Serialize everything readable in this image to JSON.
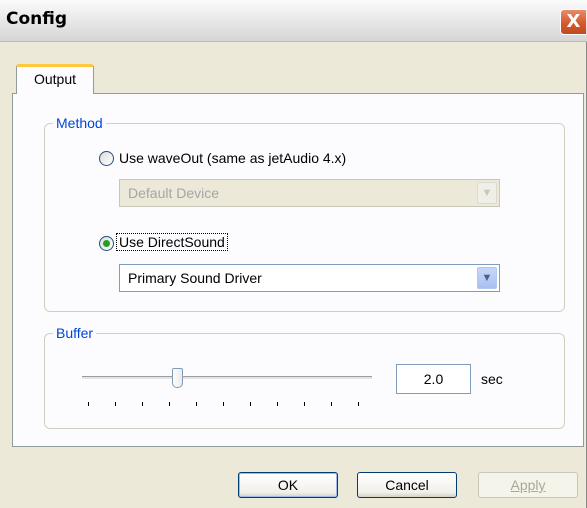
{
  "window": {
    "title": "Config",
    "close_label": "X"
  },
  "tabs": [
    {
      "label": "Output"
    }
  ],
  "method": {
    "group_label": "Method",
    "waveout_label": "Use waveOut (same as jetAudio 4.x)",
    "waveout_checked": false,
    "waveout_device": "Default Device",
    "directsound_label": "Use DirectSound",
    "directsound_checked": true,
    "directsound_device": "Primary Sound Driver"
  },
  "buffer": {
    "group_label": "Buffer",
    "value": "2.0",
    "unit": "sec",
    "slider_fraction": 0.33
  },
  "buttons": {
    "ok": "OK",
    "cancel": "Cancel",
    "apply": "Apply"
  },
  "colors": {
    "group_label": "#0046d5",
    "tab_highlight": "#ffc83c",
    "radio_dot": "#21a121"
  }
}
